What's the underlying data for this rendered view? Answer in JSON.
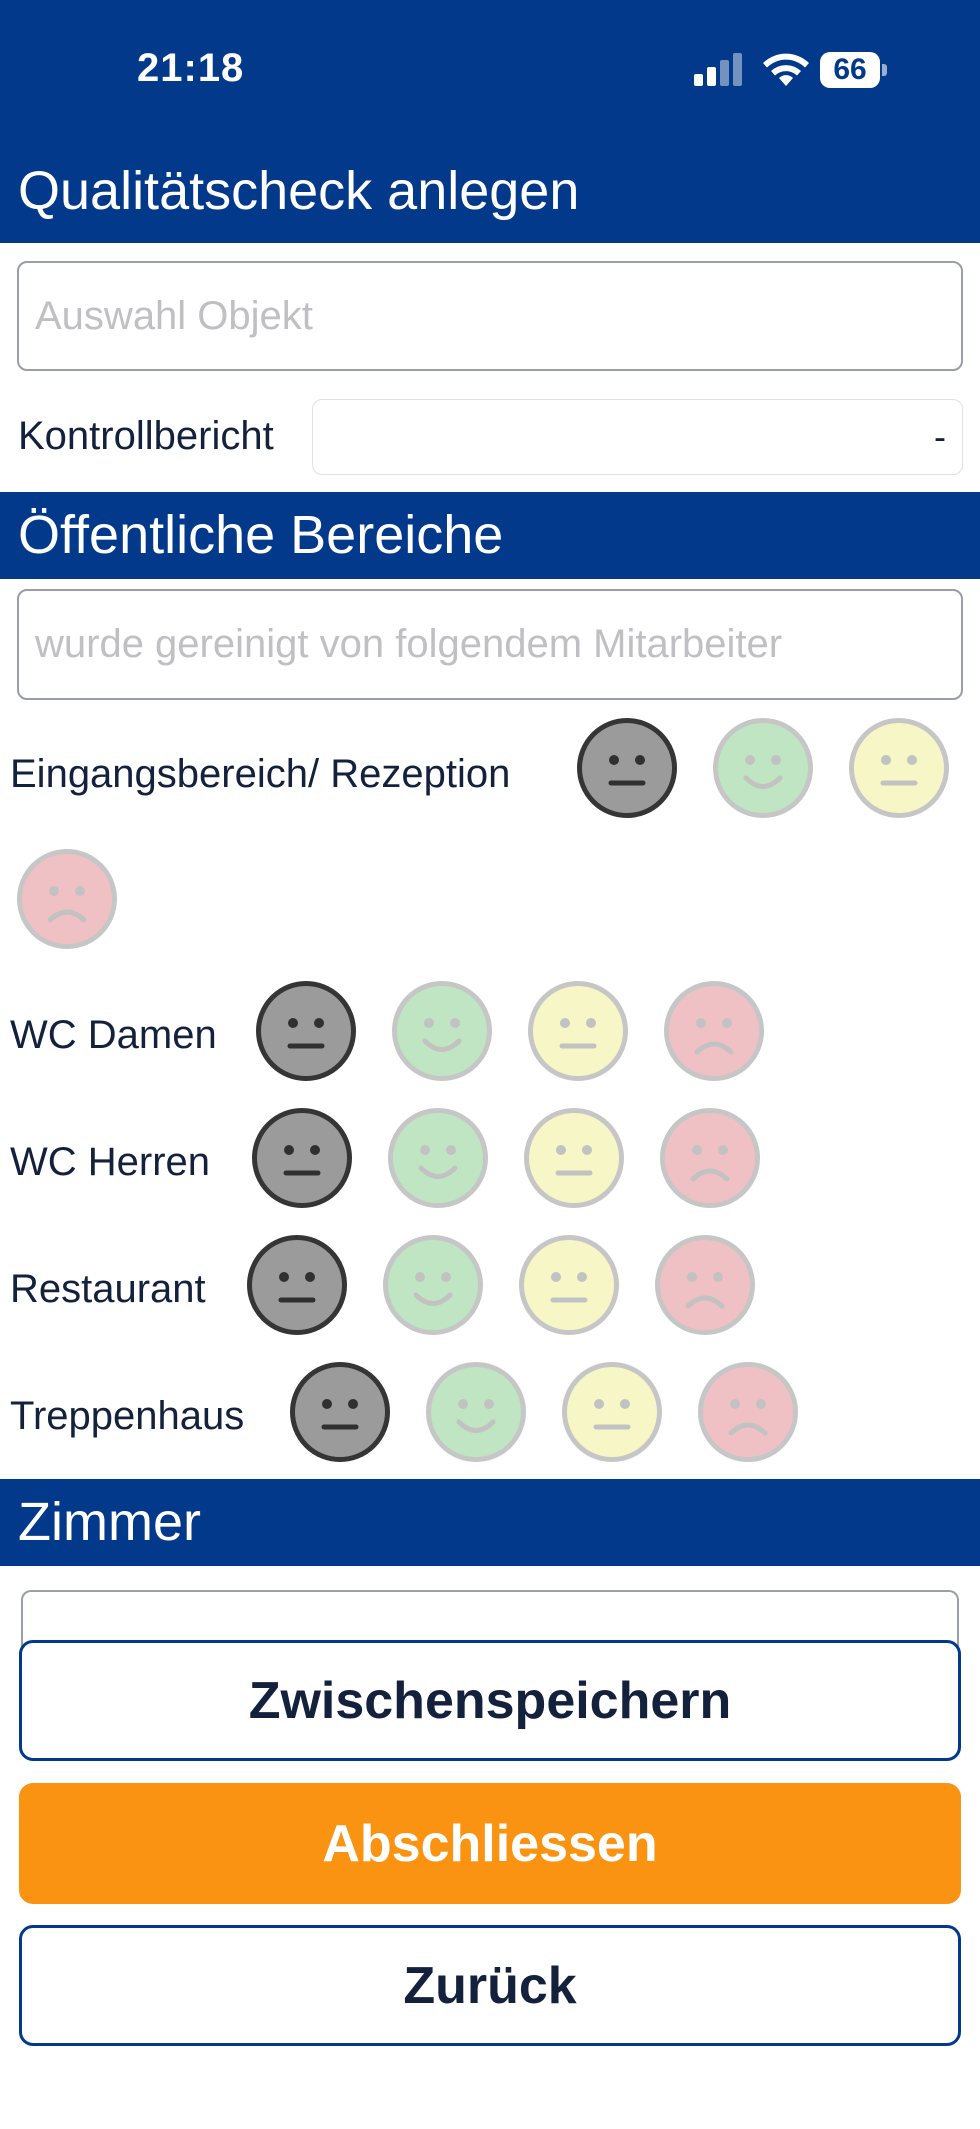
{
  "status_bar": {
    "time": "21:18",
    "battery": "66",
    "icons": [
      "signal-icon",
      "wifi-icon",
      "battery-icon"
    ]
  },
  "header": {
    "title": "Qualitätscheck anlegen"
  },
  "form": {
    "object_placeholder": "Auswahl Objekt",
    "report_label": "Kontrollbericht",
    "report_value": "-"
  },
  "sections": {
    "public": {
      "title": "Öffentliche Bereiche",
      "employee_placeholder": "wurde gereinigt von folgendem Mitarbeiter",
      "areas": [
        {
          "label": "Eingangsbereich/ Rezeption",
          "selected": "neutral-grey"
        },
        {
          "label": "WC Damen",
          "selected": "neutral-grey"
        },
        {
          "label": "WC Herren",
          "selected": "neutral-grey"
        },
        {
          "label": "Restaurant",
          "selected": "neutral-grey"
        },
        {
          "label": "Treppenhaus",
          "selected": "neutral-grey"
        }
      ],
      "rating_options": [
        "neutral-grey",
        "happy-green",
        "neutral-yellow",
        "sad-red"
      ]
    },
    "rooms": {
      "title": "Zimmer"
    }
  },
  "buttons": {
    "save_draft": "Zwischenspeichern",
    "finish": "Abschliessen",
    "back": "Zurück"
  },
  "colors": {
    "brand_blue": "#02398a",
    "accent_orange": "#fa9311",
    "rating_grey": "#9b9b9b",
    "rating_green": "#bfe5c2",
    "rating_yellow": "#f7f6c6",
    "rating_red": "#efc1c5"
  }
}
